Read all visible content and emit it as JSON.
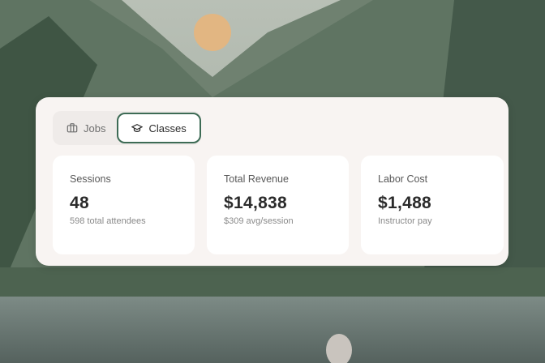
{
  "tabs": [
    {
      "label": "Jobs",
      "icon": "briefcase-icon",
      "active": false
    },
    {
      "label": "Classes",
      "icon": "graduation-cap-icon",
      "active": true
    }
  ],
  "stats": [
    {
      "label": "Sessions",
      "value": "48",
      "sub": "598 total attendees"
    },
    {
      "label": "Total Revenue",
      "value": "$14,838",
      "sub": "$309 avg/session"
    },
    {
      "label": "Labor Cost",
      "value": "$1,488",
      "sub": "Instructor pay"
    }
  ],
  "colors": {
    "panel_bg": "#f8f4f2",
    "active_tab_border": "#3d6b55",
    "card_bg": "#ffffff"
  }
}
